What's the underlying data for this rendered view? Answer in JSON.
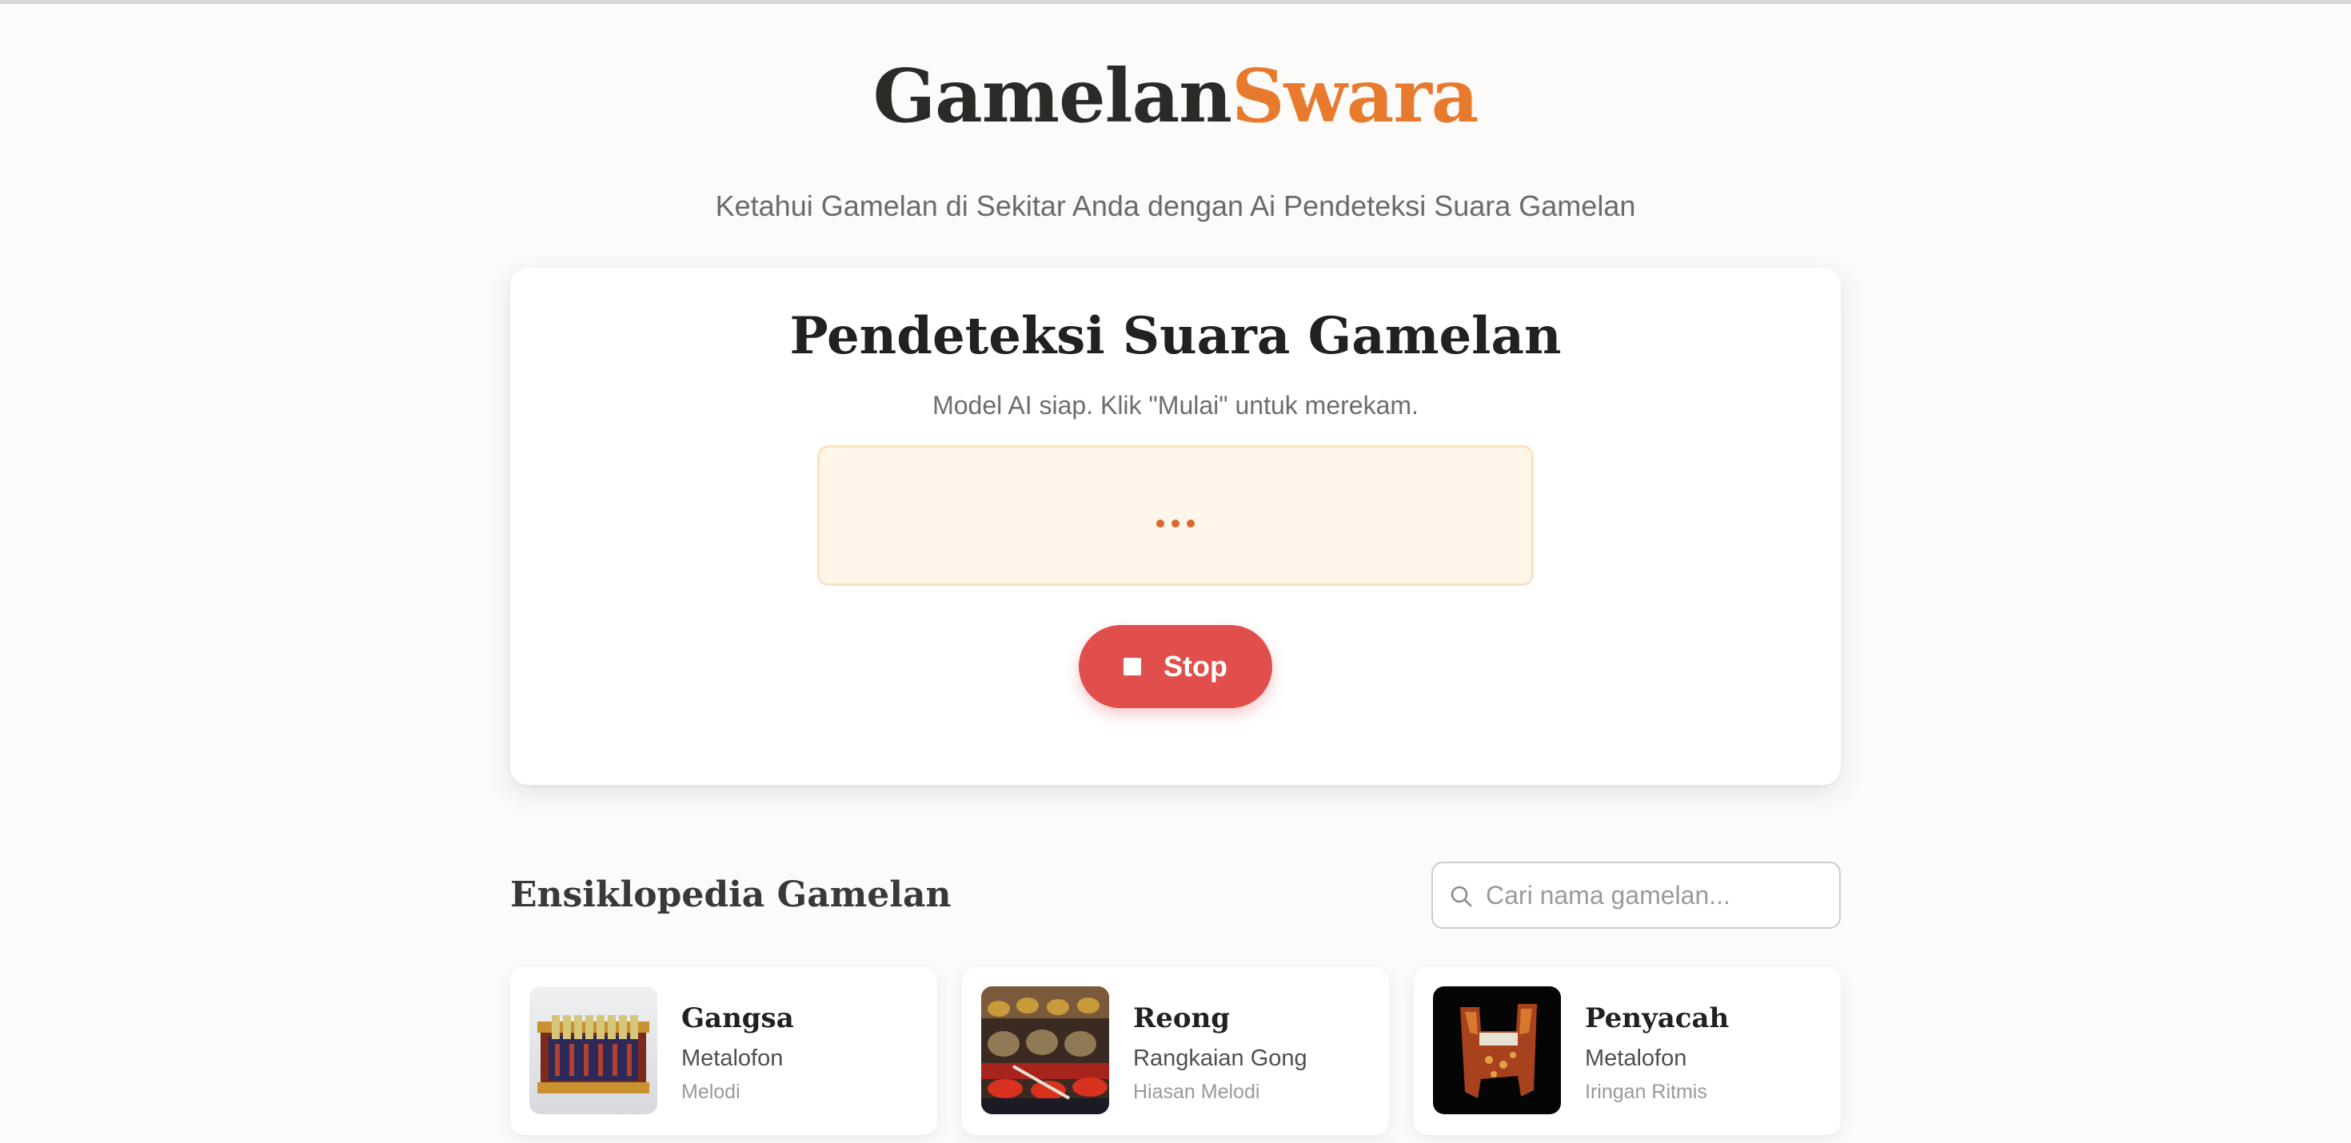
{
  "header": {
    "brand_first": "Gamelan",
    "brand_second": "Swara",
    "tagline": "Ketahui Gamelan di Sekitar Anda dengan Ai Pendeteksi Suara Gamelan"
  },
  "detector": {
    "title": "Pendeteksi Suara Gamelan",
    "status": "Model AI siap. Klik \"Mulai\" untuk merekam.",
    "result_placeholder": "...",
    "stop_label": "Stop"
  },
  "encyclopedia": {
    "title": "Ensiklopedia Gamelan",
    "search_placeholder": "Cari nama gamelan...",
    "items": [
      {
        "name": "Gangsa",
        "type": "Metalofon",
        "role": "Melodi",
        "thumb_icon": "gangsa-photo"
      },
      {
        "name": "Reong",
        "type": "Rangkaian Gong",
        "role": "Hiasan Melodi",
        "thumb_icon": "reong-photo"
      },
      {
        "name": "Penyacah",
        "type": "Metalofon",
        "role": "Iringan Ritmis",
        "thumb_icon": "penyacah-photo"
      }
    ]
  },
  "colors": {
    "brand_accent": "#e87a2e",
    "stop_button": "#e04f4b",
    "result_box_bg": "#fff5e9",
    "page_bg": "#fcfbf9"
  }
}
